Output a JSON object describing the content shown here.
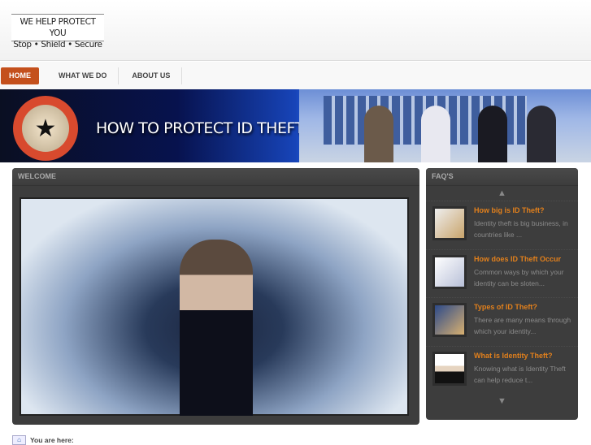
{
  "logo": {
    "line1": "WE HELP PROTECT YOU",
    "line2": "Stop • Shield • Secure"
  },
  "nav": [
    {
      "label": "HOME"
    },
    {
      "label": "WHAT WE DO"
    },
    {
      "label": "ABOUT US"
    }
  ],
  "banner": {
    "title": "HOW TO PROTECT ID THEFT"
  },
  "welcome": {
    "title": "WELCOME"
  },
  "faq": {
    "title": "FAQ'S",
    "items": [
      {
        "title": "How big is ID Theft?",
        "desc": "Identity theft is big business, in countries like ..."
      },
      {
        "title": "How does ID Theft Occur",
        "desc": "Common ways by which your identity can be sloten..."
      },
      {
        "title": "Types of ID Theft?",
        "desc": "There are many means through which your identity..."
      },
      {
        "title": "What is Identity Theft?",
        "desc": "Knowing what is Identity Theft can help reduce t..."
      }
    ]
  },
  "breadcrumb": {
    "label": "You are here:"
  },
  "colors": {
    "accent": "#c4501c",
    "faq_title": "#e2801c",
    "panel": "#3d3d3d"
  }
}
